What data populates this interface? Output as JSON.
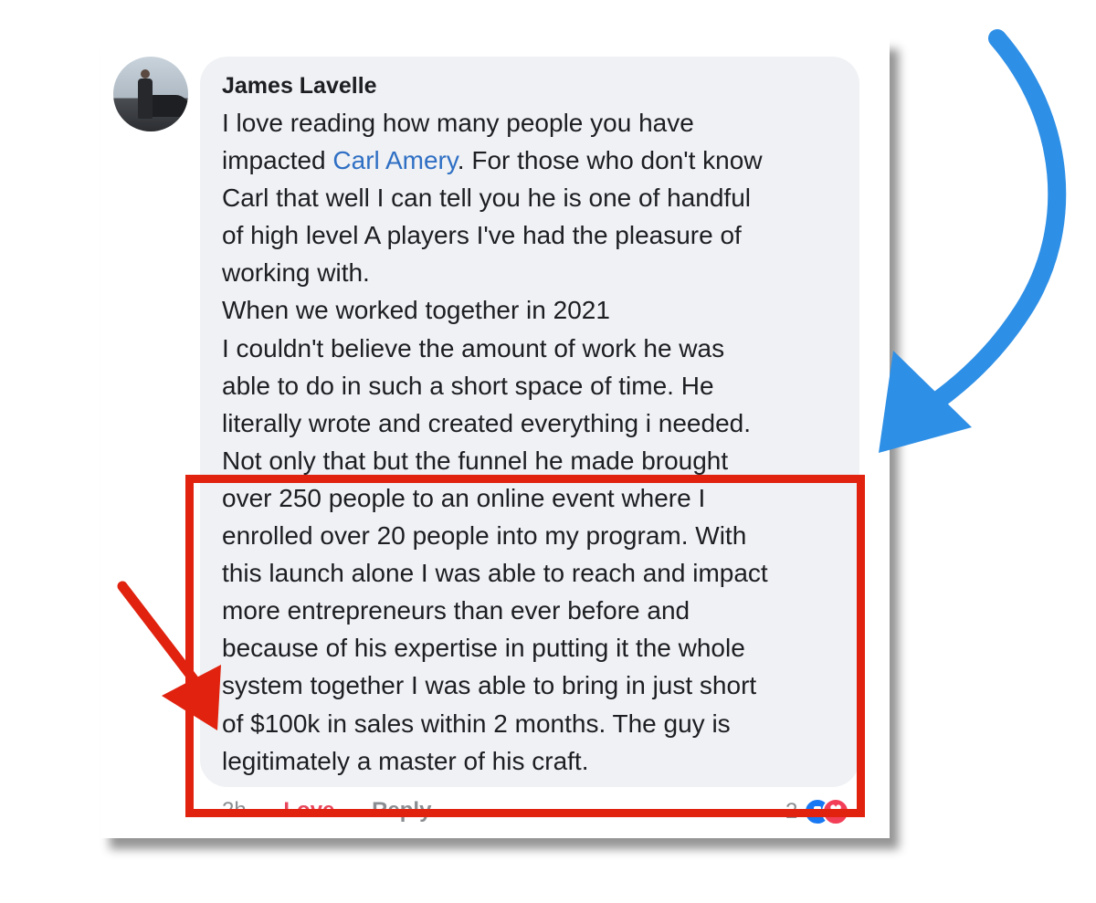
{
  "comment": {
    "author": "James Lavelle",
    "lines": [
      {
        "pre": "I love reading how many people you have",
        "mention": "",
        "post": ""
      },
      {
        "pre": "impacted ",
        "mention": "Carl Amery",
        "post": ". For those who don't know"
      },
      {
        "pre": "Carl that well I can tell you he is one of handful",
        "mention": "",
        "post": ""
      },
      {
        "pre": "of high level A players I've had the pleasure of",
        "mention": "",
        "post": ""
      },
      {
        "pre": "working with.",
        "mention": "",
        "post": ""
      },
      {
        "pre": "When we worked together in 2021",
        "mention": "",
        "post": ""
      },
      {
        "pre": "I couldn't believe the amount of work he was",
        "mention": "",
        "post": ""
      },
      {
        "pre": "able to do in such a short space of time. He",
        "mention": "",
        "post": ""
      },
      {
        "pre": "literally wrote and created everything i needed.",
        "mention": "",
        "post": ""
      },
      {
        "pre": "Not only that but the funnel he made brought",
        "mention": "",
        "post": ""
      },
      {
        "pre": "over 250 people to an online event where I",
        "mention": "",
        "post": ""
      },
      {
        "pre": "enrolled over 20 people into my program. With",
        "mention": "",
        "post": ""
      },
      {
        "pre": "this launch alone I was able to reach and impact",
        "mention": "",
        "post": ""
      },
      {
        "pre": "more entrepreneurs than ever before and",
        "mention": "",
        "post": ""
      },
      {
        "pre": "because of his expertise in putting it the whole",
        "mention": "",
        "post": ""
      },
      {
        "pre": "system together I was able to bring in just short",
        "mention": "",
        "post": ""
      },
      {
        "pre": "of $100k in sales within 2 months. The guy is",
        "mention": "",
        "post": ""
      },
      {
        "pre": "legitimately a master of his craft.",
        "mention": "",
        "post": ""
      }
    ],
    "timestamp": "2h",
    "love_label": "Love",
    "reply_label": "Reply",
    "reaction_count": "2",
    "reaction_icons": [
      "like-icon",
      "love-icon"
    ]
  },
  "colors": {
    "bubble": "#eff1f4",
    "mention": "#2f6fc4",
    "love": "#e8465b",
    "highlight_box": "#e0220f",
    "red_arrow": "#e0220f",
    "blue_arrow": "#2e8fe6"
  }
}
